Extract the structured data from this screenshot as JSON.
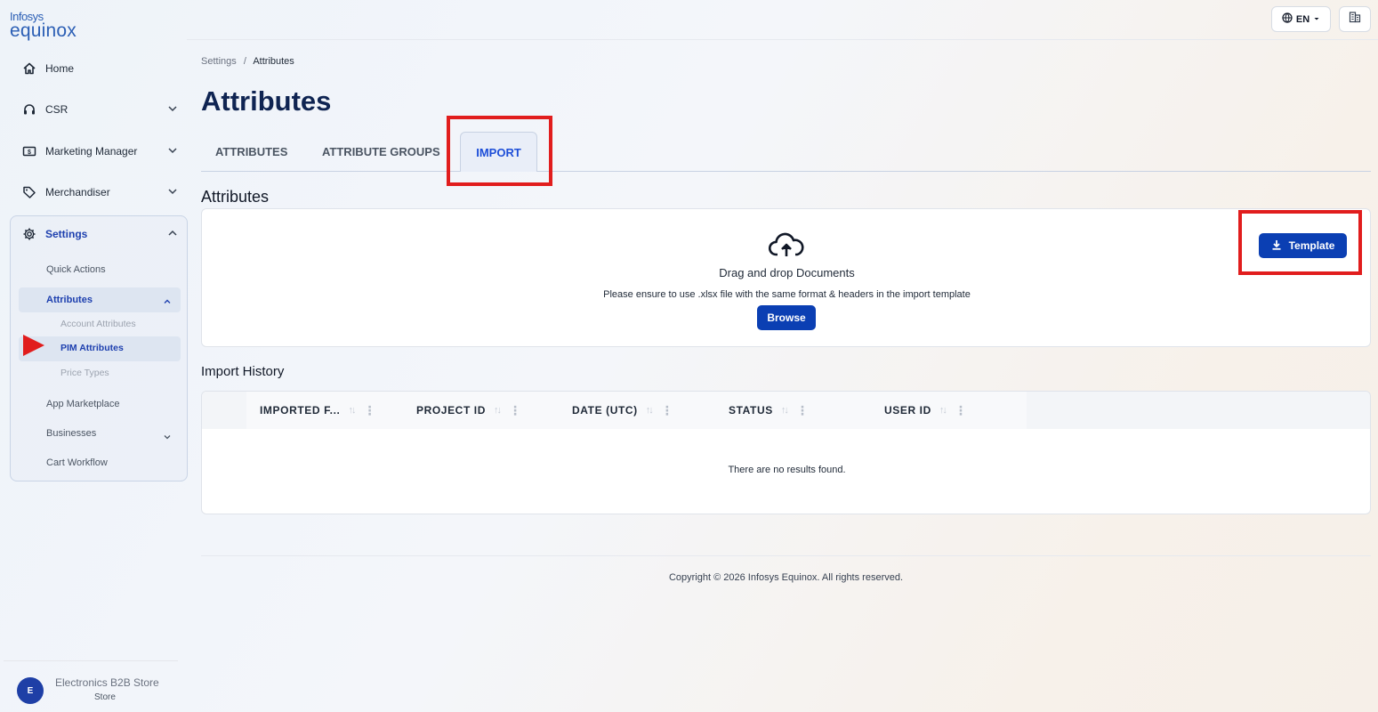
{
  "brand": {
    "line1": "Infosys",
    "line2": "equinox"
  },
  "sidebar": {
    "items": [
      {
        "label": "Home",
        "icon": "home-icon"
      },
      {
        "label": "CSR",
        "icon": "headset-icon"
      },
      {
        "label": "Marketing Manager",
        "icon": "money-icon"
      },
      {
        "label": "Merchandiser",
        "icon": "tag-icon"
      },
      {
        "label": "Settings",
        "icon": "gear-icon"
      }
    ],
    "settings_sub": {
      "quick_actions": "Quick Actions",
      "attributes": "Attributes",
      "account_attributes": "Account Attributes",
      "pim_attributes": "PIM Attributes",
      "price_types": "Price Types",
      "app_marketplace": "App Marketplace",
      "businesses": "Businesses",
      "cart_workflow": "Cart Workflow"
    },
    "store": {
      "avatar": "E",
      "name": "Electronics B2B Store",
      "type": "Store"
    }
  },
  "topbar": {
    "language": "EN"
  },
  "breadcrumb": {
    "parent": "Settings",
    "separator": "/",
    "current": "Attributes"
  },
  "page_title": "Attributes",
  "tabs": [
    {
      "label": "ATTRIBUTES",
      "active": false
    },
    {
      "label": "ATTRIBUTE GROUPS",
      "active": false
    },
    {
      "label": "IMPORT",
      "active": true
    }
  ],
  "upload": {
    "section_title": "Attributes",
    "drag_text": "Drag and drop Documents",
    "hint": "Please ensure to use .xlsx file with the same format & headers in the import template",
    "browse_label": "Browse",
    "template_label": "Template"
  },
  "history": {
    "title": "Import History",
    "columns": [
      "IMPORTED F...",
      "PROJECT ID",
      "DATE (UTC)",
      "STATUS",
      "USER ID"
    ],
    "empty_text": "There are no results found."
  },
  "footer": {
    "copyright": "Copyright © 2026 Infosys Equinox. All rights reserved."
  },
  "colors": {
    "primary": "#0b3fb3",
    "title": "#0f2452",
    "highlight": "#e11d1d"
  }
}
